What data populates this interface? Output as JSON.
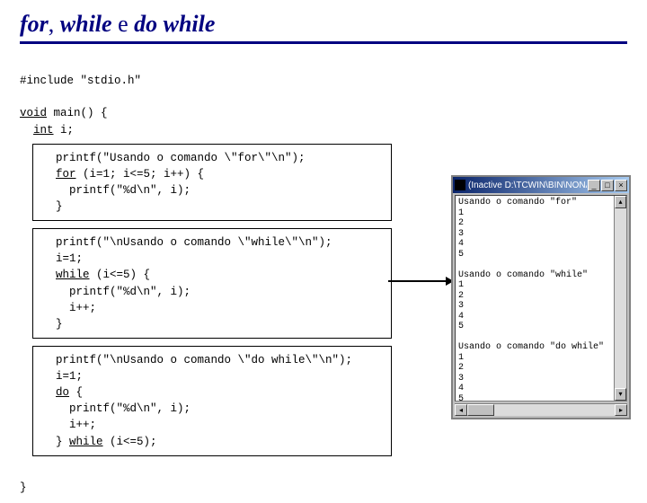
{
  "title": {
    "k1": "for",
    "s1": ", ",
    "k2": "while",
    "mid": " e ",
    "k3": "do while"
  },
  "code": {
    "include": "#include \"stdio.h\"",
    "voidmain": "void",
    "main_rest": " main() {",
    "int_kw": "int",
    "int_rest": " i;",
    "closebrace": "}"
  },
  "box1": {
    "l1a": "  printf(\"Usando o comando \\\"for\\\"\\n\");",
    "l2a": "  ",
    "l2kw": "for",
    "l2b": " (i=1; i<=5; i++) {",
    "l3": "    printf(\"%d\\n\", i);",
    "l4": "  }"
  },
  "box2": {
    "l1": "  printf(\"\\nUsando o comando \\\"while\\\"\\n\");",
    "l2": "  i=1;",
    "l3a": "  ",
    "l3kw": "while",
    "l3b": " (i<=5) {",
    "l4": "    printf(\"%d\\n\", i);",
    "l5": "    i++;",
    "l6": "  }"
  },
  "box3": {
    "l1": "  printf(\"\\nUsando o comando \\\"do while\\\"\\n\");",
    "l2": "  i=1;",
    "l3a": "  ",
    "l3kw": "do",
    "l3b": " {",
    "l4": "    printf(\"%d\\n\", i);",
    "l5": "    i++;",
    "l6a": "  } ",
    "l6kw": "while",
    "l6b": " (i<=5);"
  },
  "console": {
    "title": "(Inactive D:\\TCWIN\\BIN\\NONA...",
    "btn_min": "_",
    "btn_max": "□",
    "btn_close": "×",
    "output": "Usando o comando \"for\"\n1\n2\n3\n4\n5\n\nUsando o comando \"while\"\n1\n2\n3\n4\n5\n\nUsando o comando \"do while\"\n1\n2\n3\n4\n5",
    "up": "▴",
    "down": "▾",
    "left": "◂",
    "right": "▸"
  }
}
